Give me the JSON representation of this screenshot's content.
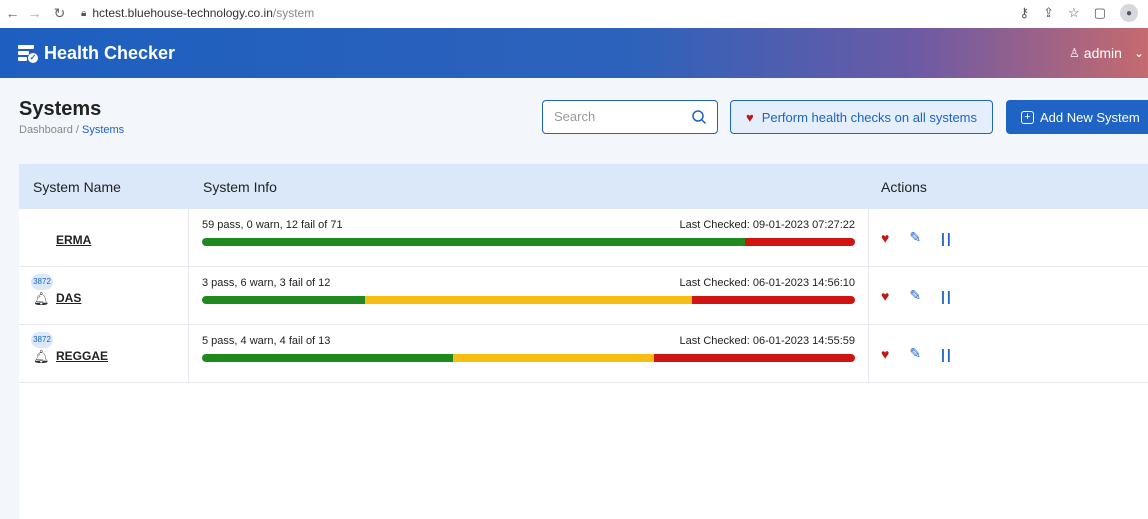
{
  "browser": {
    "url_host": "hctest.bluehouse-technology.co.in",
    "url_path": "/system"
  },
  "app": {
    "brand": "Health Checker",
    "user": "admin"
  },
  "page": {
    "title": "Systems",
    "breadcrumb": {
      "root": "Dashboard",
      "separator": " / ",
      "current": "Systems"
    },
    "search_placeholder": "Search",
    "health_button_label": "Perform health checks on all systems",
    "add_button_label": "Add New System"
  },
  "table": {
    "headers": {
      "name": "System Name",
      "info": "System Info",
      "actions": "Actions"
    },
    "rows": [
      {
        "name": "ERMA",
        "badge": "",
        "summary": "59 pass, 0 warn, 12 fail of 71",
        "last_checked": "Last Checked: 09-01-2023 07:27:22",
        "pass": 59,
        "warn": 0,
        "fail": 12,
        "total": 71
      },
      {
        "name": "DAS",
        "badge": "3872",
        "summary": "3 pass, 6 warn, 3 fail of 12",
        "last_checked": "Last Checked: 06-01-2023 14:56:10",
        "pass": 3,
        "warn": 6,
        "fail": 3,
        "total": 12
      },
      {
        "name": "REGGAE",
        "badge": "3872",
        "summary": "5 pass, 4 warn, 4 fail of 13",
        "last_checked": "Last Checked: 06-01-2023 14:55:59",
        "pass": 5,
        "warn": 4,
        "fail": 4,
        "total": 13
      }
    ]
  },
  "colors": {
    "primary": "#1f63c4",
    "pass": "#208a20",
    "warn": "#f7bd12",
    "fail": "#d01414"
  }
}
